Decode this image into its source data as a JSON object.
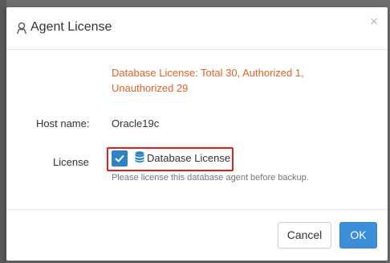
{
  "dialog": {
    "title": "Agent License",
    "close_symbol": "×"
  },
  "info_text": "Database License: Total 30, Authorized 1, Unauthorized 29",
  "form": {
    "host_label": "Host name:",
    "host_value": "Oracle19c",
    "license_label": "License",
    "license_option": "Database License",
    "license_checked": true,
    "help_text": "Please license this database agent before backup."
  },
  "footer": {
    "cancel_label": "Cancel",
    "ok_label": "OK"
  },
  "colors": {
    "accent": "#2b84c6",
    "info": "#e0642a",
    "highlight_border": "#e02020",
    "ok_button": "#3d8ed8"
  },
  "icons": {
    "title_icon": "agent-icon",
    "license_icon": "database-icon",
    "check_icon": "checkmark-icon"
  }
}
